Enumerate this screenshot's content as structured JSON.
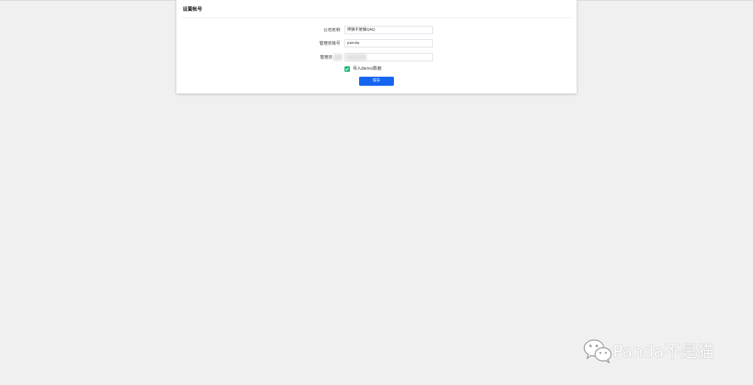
{
  "card": {
    "title": "设置帐号"
  },
  "form": {
    "company_label": "公司名称",
    "company_value": "熊猫不是猫QAQ",
    "admin_account_label": "管理员账号",
    "admin_account_value": "panda",
    "admin_password_label": "管理员",
    "admin_password_value": ""
  },
  "import_demo": {
    "label": "导入demo数据",
    "checked": true
  },
  "save_button": {
    "label": "保存"
  },
  "watermark": {
    "text": "Panda不是猫"
  },
  "colors": {
    "page_background": "#f0f0f0",
    "card_background": "#ffffff",
    "primary_button": "#1565f0",
    "checkbox_checked": "#1fb97c"
  }
}
